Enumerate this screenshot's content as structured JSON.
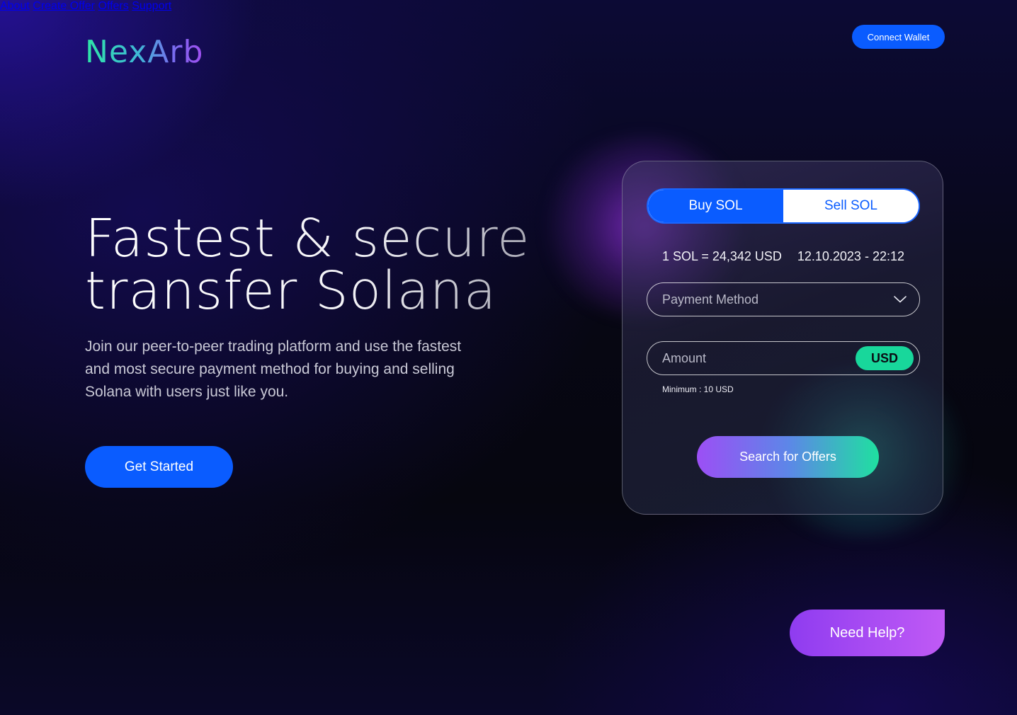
{
  "brand": {
    "name": "NexArb"
  },
  "nav": {
    "items": [
      {
        "label": "About"
      },
      {
        "label": "Create Offer"
      },
      {
        "label": "Offers"
      },
      {
        "label": "Support"
      }
    ],
    "connect_label": "Connect Wallet"
  },
  "hero": {
    "title_line1": "Fastest & secure",
    "title_line2": "transfer Solana",
    "subtitle": "Join our peer-to-peer trading platform and use the fastest and most secure payment method for buying and selling Solana with users just like you.",
    "cta_label": "Get Started"
  },
  "trade_card": {
    "tabs": [
      {
        "label": "Buy SOL",
        "active": true
      },
      {
        "label": "Sell SOL",
        "active": false
      }
    ],
    "rate": "1 SOL = 24,342 USD",
    "datetime": "12.10.2023 - 22:12",
    "payment_method_placeholder": "Payment Method",
    "amount_placeholder": "Amount",
    "currency": "USD",
    "minimum": "Minimum : 10 USD",
    "search_label": "Search for Offers"
  },
  "help": {
    "label": "Need Help?"
  },
  "colors": {
    "primary_blue": "#0a5cff",
    "accent_green": "#18d79b",
    "accent_purple": "#9c4ff5"
  },
  "icons": {
    "dropdown": "chevron-down-icon"
  }
}
